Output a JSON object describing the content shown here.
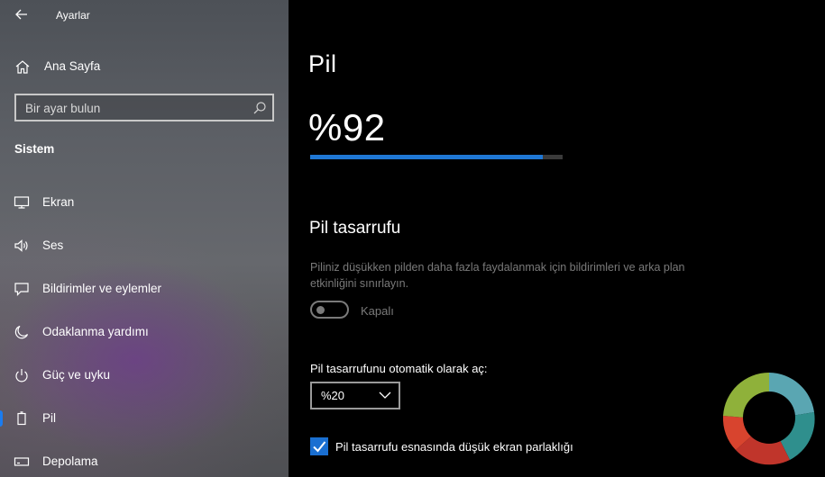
{
  "app": {
    "title": "Ayarlar"
  },
  "sidebar": {
    "home_label": "Ana Sayfa",
    "search_placeholder": "Bir ayar bulun",
    "section_title": "Sistem",
    "items": [
      {
        "label": "Ekran",
        "icon": "monitor-icon"
      },
      {
        "label": "Ses",
        "icon": "speaker-icon"
      },
      {
        "label": "Bildirimler ve eylemler",
        "icon": "notification-icon"
      },
      {
        "label": "Odaklanma yardımı",
        "icon": "moon-icon"
      },
      {
        "label": "Güç ve uyku",
        "icon": "power-icon"
      },
      {
        "label": "Pil",
        "icon": "battery-icon",
        "selected": true
      },
      {
        "label": "Depolama",
        "icon": "storage-icon"
      }
    ]
  },
  "main": {
    "title": "Pil",
    "battery_percent_text": "%92",
    "battery_level": 0.92,
    "saver": {
      "title": "Pil tasarrufu",
      "description": "Piliniz düşükken pilden daha fazla faydalanmak için bildirimleri ve arka plan etkinliğini sınırlayın.",
      "toggle_state": "Kapalı",
      "auto_label": "Pil tasarrufunu otomatik olarak aç:",
      "auto_value": "%20",
      "brightness_label": "Pil tasarrufu esnasında düşük ekran parlaklığı",
      "brightness_checked": true
    }
  },
  "colors": {
    "accent": "#1a7cf0",
    "battery_fill": "#1f77d4"
  }
}
